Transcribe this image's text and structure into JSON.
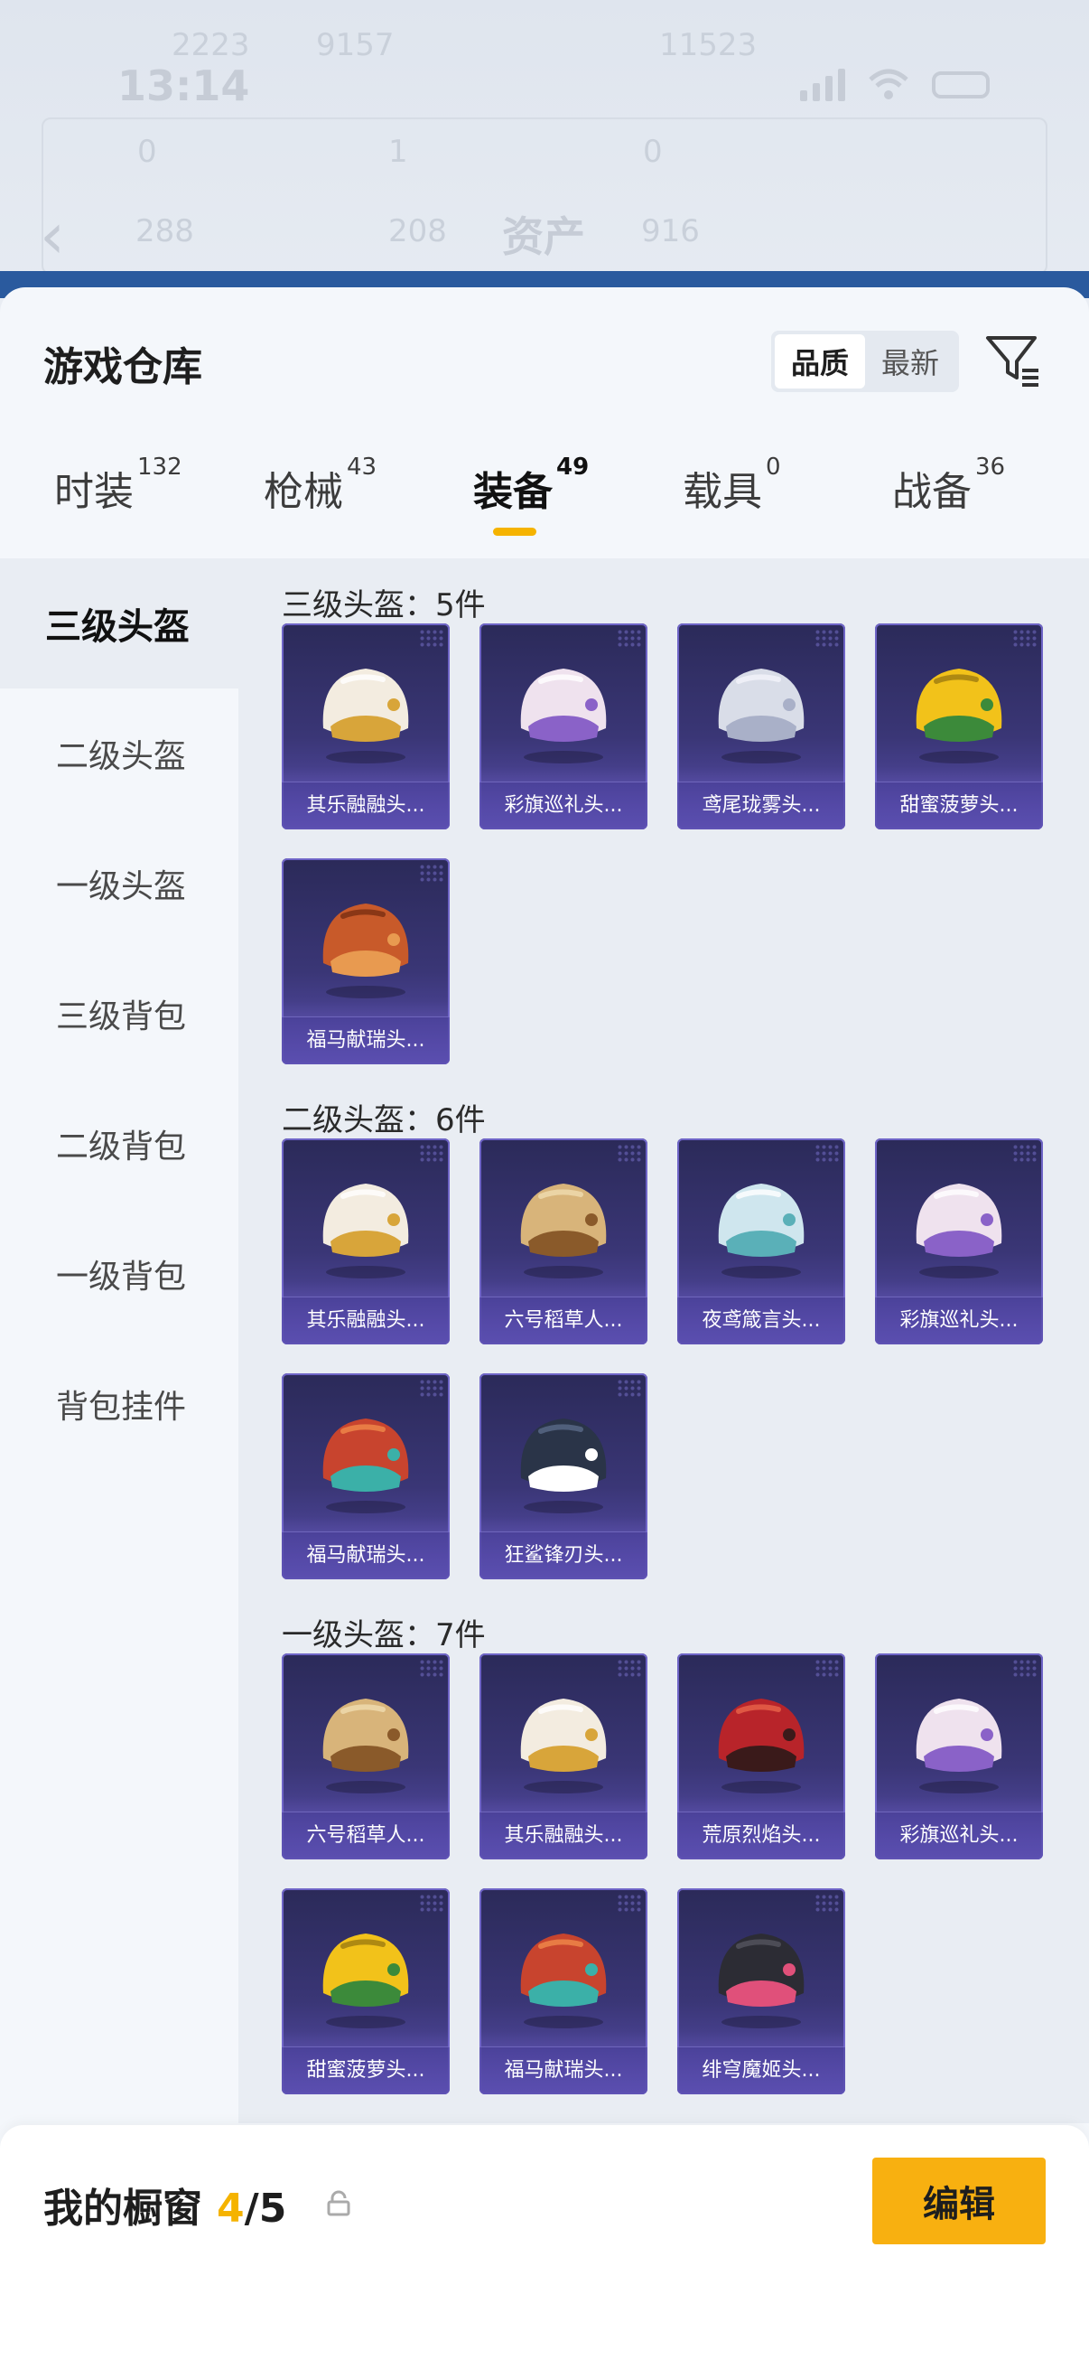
{
  "status_bar": {
    "time": "13:14"
  },
  "background_app": {
    "title": "资产",
    "faint_stats": [
      "2223",
      "9157",
      "11523",
      "0",
      "1",
      "0",
      "288",
      "208",
      "916"
    ]
  },
  "panel": {
    "title": "游戏仓库",
    "sort_options": [
      "品质",
      "最新"
    ],
    "sort_selected": "品质"
  },
  "tabs": [
    {
      "label": "时装",
      "count": "132"
    },
    {
      "label": "枪械",
      "count": "43"
    },
    {
      "label": "装备",
      "count": "49",
      "active": true
    },
    {
      "label": "载具",
      "count": "0"
    },
    {
      "label": "战备",
      "count": "36"
    }
  ],
  "sidebar": [
    {
      "label": "三级头盔",
      "active": true
    },
    {
      "label": "二级头盔"
    },
    {
      "label": "一级头盔"
    },
    {
      "label": "三级背包"
    },
    {
      "label": "二级背包"
    },
    {
      "label": "一级背包"
    },
    {
      "label": "背包挂件"
    }
  ],
  "sections": [
    {
      "title": "三级头盔：5件",
      "items": [
        {
          "name": "其乐融融头...",
          "icon": "helmet-white-gold"
        },
        {
          "name": "彩旗巡礼头...",
          "icon": "helmet-pink-party"
        },
        {
          "name": "鸢尾珑雾头...",
          "icon": "helmet-silver-lace"
        },
        {
          "name": "甜蜜菠萝头...",
          "icon": "helmet-pineapple"
        },
        {
          "name": "福马献瑞头...",
          "icon": "helmet-horse-red"
        }
      ]
    },
    {
      "title": "二级头盔：6件",
      "items": [
        {
          "name": "其乐融融头...",
          "icon": "helmet-white-gold"
        },
        {
          "name": "六号稻草人...",
          "icon": "helmet-scarecrow"
        },
        {
          "name": "夜鸢箴言头...",
          "icon": "helmet-owl"
        },
        {
          "name": "彩旗巡礼头...",
          "icon": "helmet-pink-party"
        },
        {
          "name": "福马献瑞头...",
          "icon": "helmet-red-dome"
        },
        {
          "name": "狂鲨锋刃头...",
          "icon": "helmet-shark"
        }
      ]
    },
    {
      "title": "一级头盔：7件",
      "items": [
        {
          "name": "六号稻草人...",
          "icon": "helmet-scarecrow"
        },
        {
          "name": "其乐融融头...",
          "icon": "helmet-white-gold"
        },
        {
          "name": "荒原烈焰头...",
          "icon": "helmet-red-flame"
        },
        {
          "name": "彩旗巡礼头...",
          "icon": "helmet-pink-party"
        },
        {
          "name": "甜蜜菠萝头...",
          "icon": "helmet-pineapple"
        },
        {
          "name": "福马献瑞头...",
          "icon": "helmet-red-dome"
        },
        {
          "name": "绯穹魔姬头...",
          "icon": "helmet-black-cat"
        }
      ]
    }
  ],
  "footer": {
    "title": "我的橱窗",
    "current": "4",
    "total": "/5",
    "edit_label": "编辑"
  },
  "colors": {
    "accent": "#f5b300",
    "card_top": "#2b2a59",
    "card_bottom": "#5a4fb0"
  }
}
